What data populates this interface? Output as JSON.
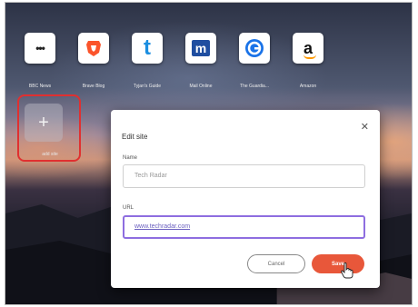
{
  "speed_dials": [
    {
      "label": "BBC News",
      "icon": "more-dots-icon"
    },
    {
      "label": "Brave Blog",
      "icon": "brave-lion-icon"
    },
    {
      "label": "Tyjan's Guide",
      "icon": "letter-t-icon"
    },
    {
      "label": "Mail Online",
      "icon": "letter-m-icon"
    },
    {
      "label": "The Guardia...",
      "icon": "guardian-icon"
    },
    {
      "label": "Amazon",
      "icon": "amazon-icon"
    }
  ],
  "add_site": {
    "plus": "+",
    "label": "add site"
  },
  "dialog": {
    "title": "Edit site",
    "close": "✕",
    "name_label": "Name",
    "name_value": "Tech Radar",
    "url_label": "URL",
    "url_value": "www.techradar.com",
    "cancel_label": "Cancel",
    "save_label": "Save"
  },
  "colors": {
    "accent": "#e8573a",
    "highlight": "#e03030",
    "focus": "#8e6ee0"
  }
}
